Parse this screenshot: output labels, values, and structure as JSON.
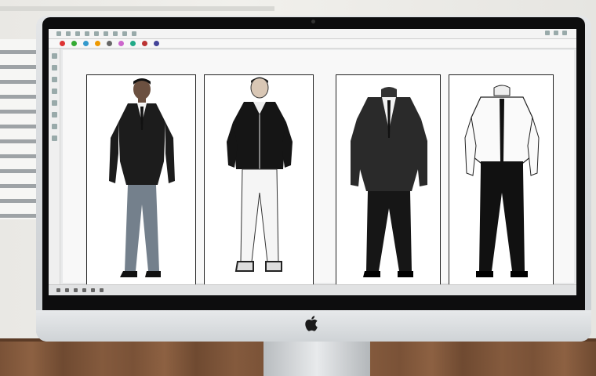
{
  "app": {
    "panels": [
      {
        "name": "businessman-casual-jacket"
      },
      {
        "name": "man-bomber-jacket"
      },
      {
        "name": "black-suit-on-mannequin"
      },
      {
        "name": "white-shirt-black-pants-on-mannequin"
      }
    ],
    "toolbar_icon_colors": [
      "#d33",
      "#3a3",
      "#39c",
      "#e90",
      "#666",
      "#c6c",
      "#2a8",
      "#b33",
      "#449"
    ]
  }
}
